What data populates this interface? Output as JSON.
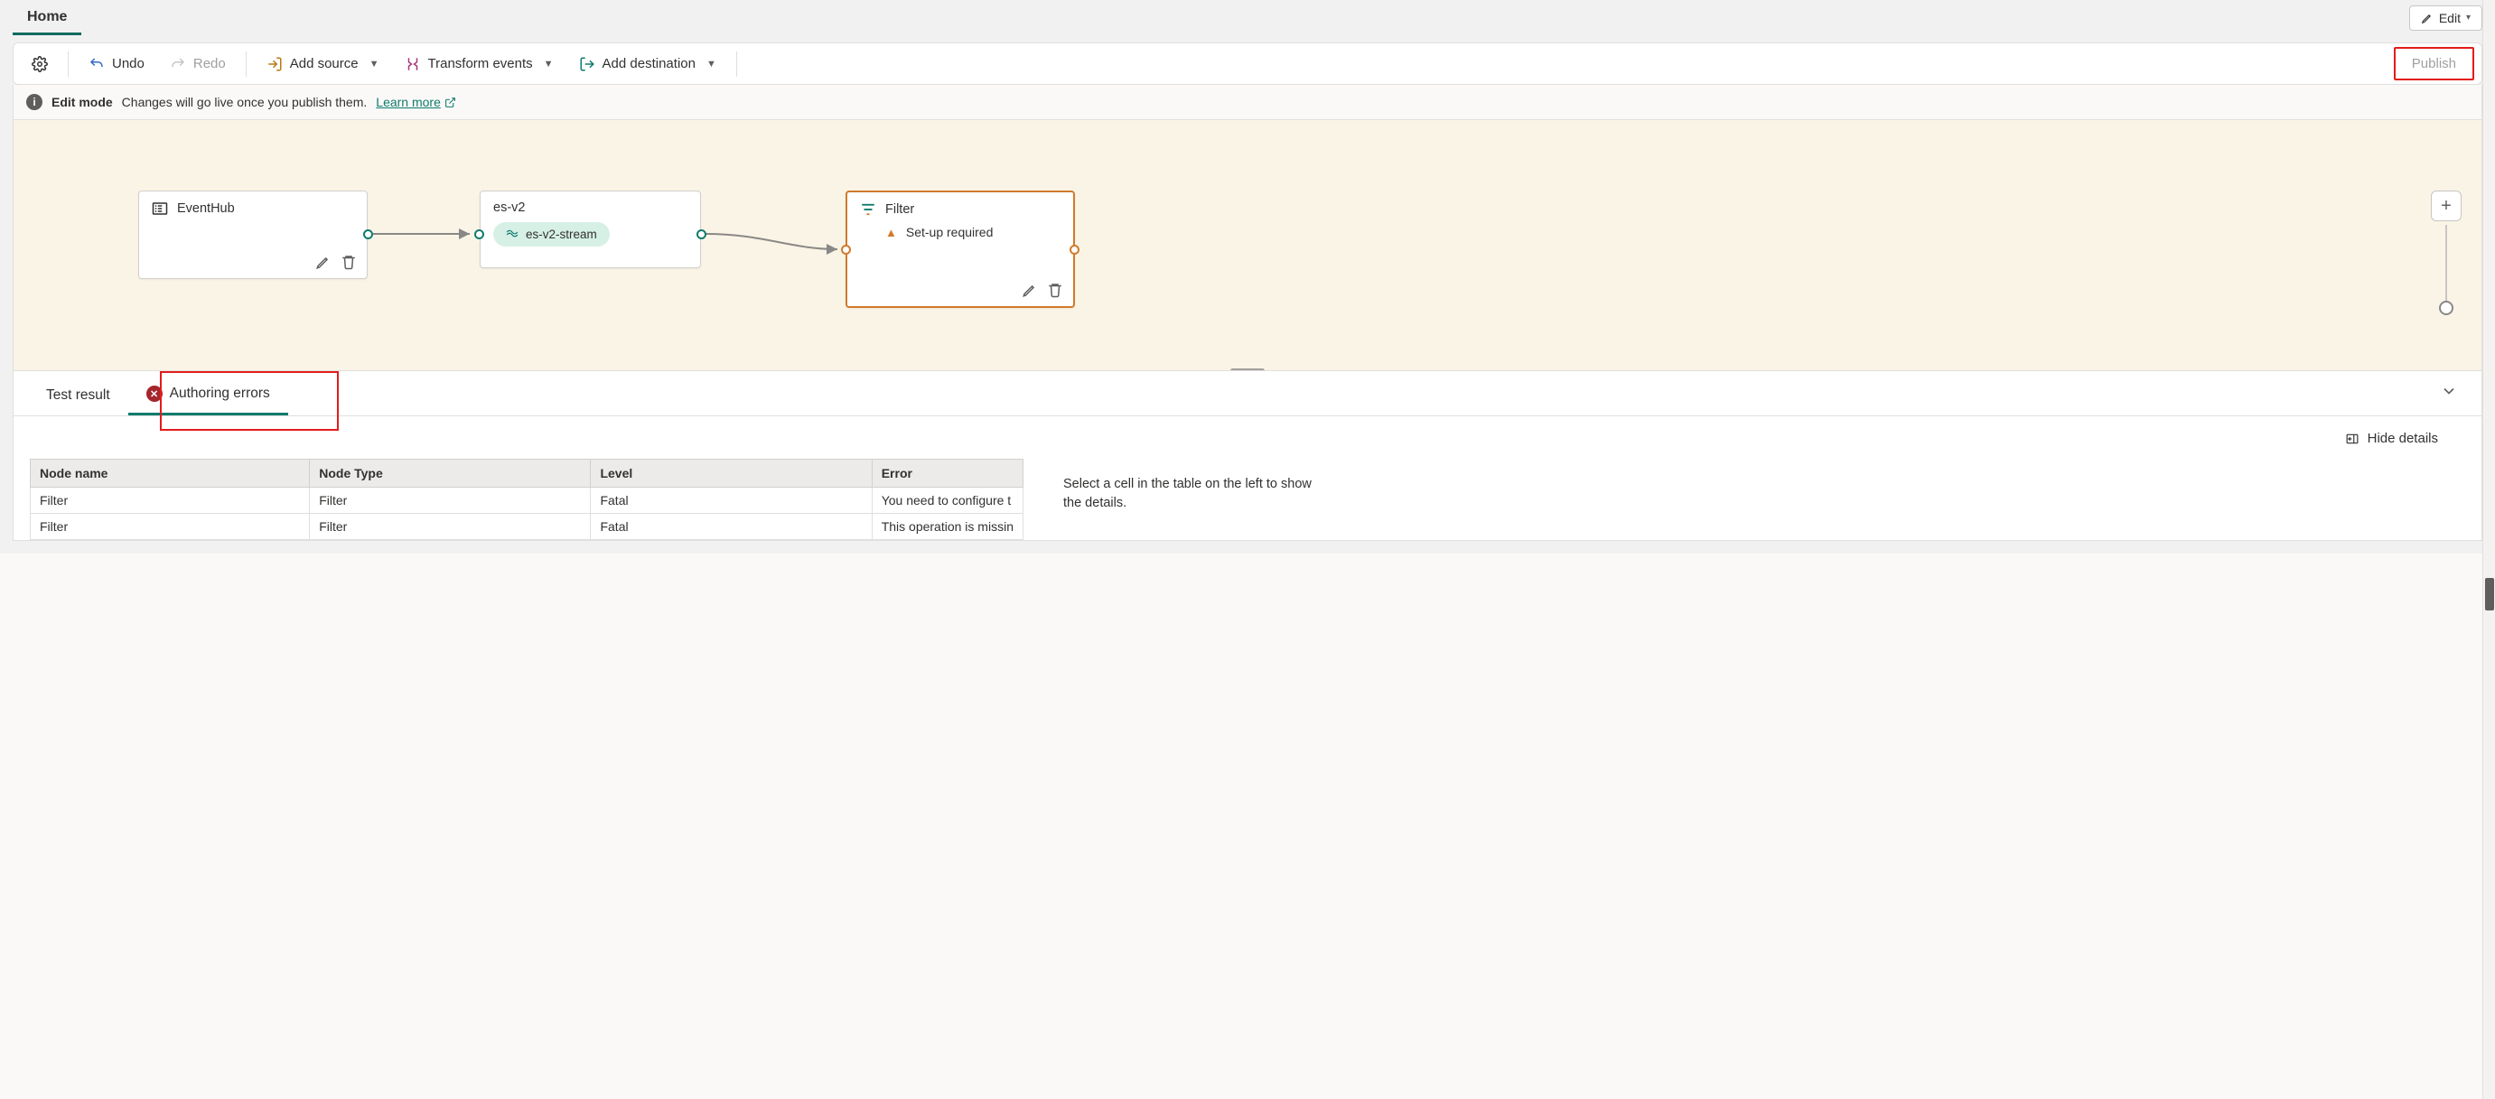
{
  "header": {
    "tab": "Home",
    "edit_btn": "Edit"
  },
  "toolbar": {
    "undo": "Undo",
    "redo": "Redo",
    "add_source": "Add source",
    "transform": "Transform events",
    "add_dest": "Add destination",
    "publish": "Publish"
  },
  "banner": {
    "title": "Edit mode",
    "msg": "Changes will go live once you publish them.",
    "link": "Learn more"
  },
  "nodes": {
    "eventhub": {
      "title": "EventHub"
    },
    "esv2": {
      "title": "es-v2",
      "chip": "es-v2-stream"
    },
    "filter": {
      "title": "Filter",
      "warn": "Set-up required"
    }
  },
  "bottom": {
    "tab_test": "Test result",
    "tab_errors": "Authoring errors",
    "hide_details": "Hide details",
    "side_msg": "Select a cell in the table on the left to show the details.",
    "columns": {
      "name": "Node name",
      "type": "Node Type",
      "level": "Level",
      "error": "Error"
    },
    "rows": [
      {
        "name": "Filter",
        "type": "Filter",
        "level": "Fatal",
        "error": "You need to configure t"
      },
      {
        "name": "Filter",
        "type": "Filter",
        "level": "Fatal",
        "error": "This operation is missin"
      }
    ]
  }
}
